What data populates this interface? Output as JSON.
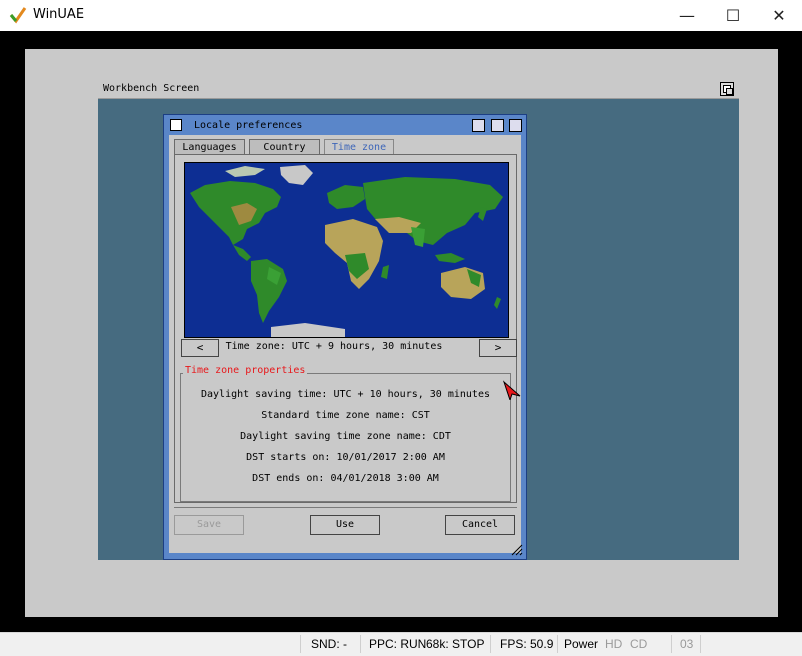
{
  "window": {
    "title": "WinUAE",
    "controls": {
      "minimize": "—",
      "maximize": "☐",
      "close": "✕"
    }
  },
  "workbench": {
    "title": "Workbench Screen"
  },
  "locale_prefs": {
    "title": "Locale preferences",
    "tabs": [
      {
        "label": "Languages",
        "active": false
      },
      {
        "label": "Country",
        "active": false
      },
      {
        "label": "Time zone",
        "active": true
      }
    ],
    "prev_button": "<",
    "next_button": ">",
    "time_zone_label": "Time zone: UTC + 9 hours, 30 minutes",
    "properties": {
      "legend": "Time zone properties",
      "daylight_saving_time": "Daylight saving time: UTC + 10 hours, 30 minutes",
      "standard_name": "Standard time zone name: CST",
      "daylight_name": "Daylight saving time zone name: CDT",
      "dst_starts": "DST starts on: 10/01/2017 2:00 AM",
      "dst_ends": "DST ends on: 04/01/2018 3:00 AM"
    },
    "buttons": {
      "save": "Save",
      "use": "Use",
      "cancel": "Cancel"
    },
    "colors": {
      "window_blue": "#5a86c9",
      "ocean": "#0d2e93",
      "land": "#2f8a2a",
      "desert": "#b8a45a",
      "legend_red": "#e8181b"
    }
  },
  "statusbar": {
    "snd": "SND: -",
    "ppc": "PPC: RUN",
    "k68": "68k: STOP",
    "fps": "FPS: 50.9",
    "power": "Power",
    "hd": "HD",
    "cd": "CD",
    "df": "03"
  }
}
